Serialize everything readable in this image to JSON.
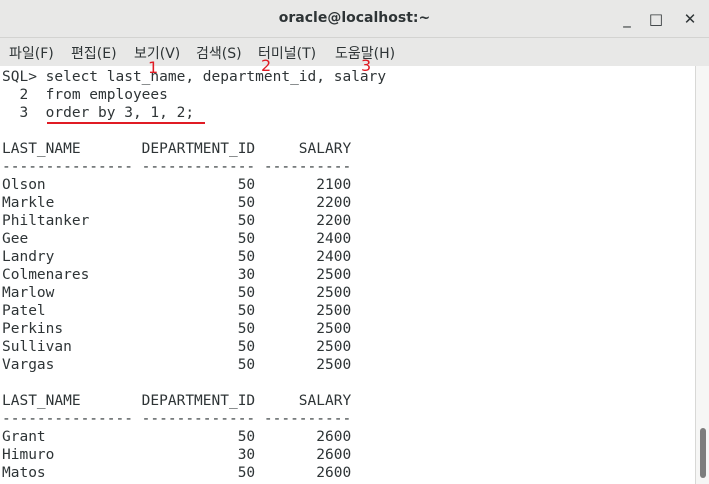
{
  "window": {
    "title": "oracle@localhost:~",
    "minimize": "_",
    "maximize": "□",
    "close": "✕"
  },
  "menu": [
    "파일(F)",
    "편집(E)",
    "보기(V)",
    "검색(S)",
    "터미널(T)",
    "도움말(H)"
  ],
  "terminal_lines": [
    "SQL> select last_name, department_id, salary",
    "  2  from employees",
    "  3  order by 3, 1, 2;",
    "",
    "LAST_NAME       DEPARTMENT_ID     SALARY",
    "--------------- ------------- ----------",
    "Olson                      50       2100",
    "Markle                     50       2200",
    "Philtanker                 50       2200",
    "Gee                        50       2400",
    "Landry                     50       2400",
    "Colmenares                 30       2500",
    "Marlow                     50       2500",
    "Patel                      50       2500",
    "Perkins                    50       2500",
    "Sullivan                   50       2500",
    "Vargas                     50       2500",
    "",
    "LAST_NAME       DEPARTMENT_ID     SALARY",
    "--------------- ------------- ----------",
    "Grant                      50       2600",
    "Himuro                     30       2600",
    "Matos                      50       2600"
  ],
  "annotations": [
    "1",
    "2",
    "3"
  ],
  "colors": {
    "annotation": "#e01b24",
    "terminal_bg": "#ffffff",
    "text": "#2e3436"
  }
}
